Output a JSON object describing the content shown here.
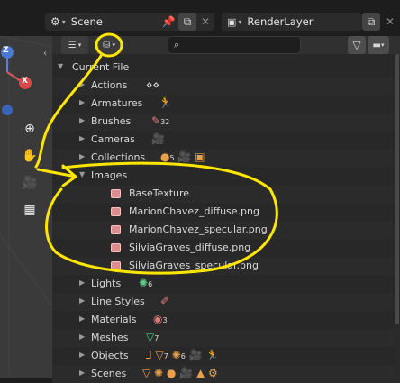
{
  "header": {
    "scene_name": "Scene",
    "view_layer_name": "RenderLayer"
  },
  "outliner": {
    "search_placeholder": "",
    "root": "Current File",
    "categories": [
      {
        "label": "Actions",
        "count": ""
      },
      {
        "label": "Armatures",
        "count": ""
      },
      {
        "label": "Brushes",
        "count": "32"
      },
      {
        "label": "Cameras",
        "count": ""
      },
      {
        "label": "Collections",
        "count": "5"
      },
      {
        "label": "Images",
        "count": ""
      },
      {
        "label": "Lights",
        "count": "6"
      },
      {
        "label": "Line Styles",
        "count": ""
      },
      {
        "label": "Materials",
        "count": "3"
      },
      {
        "label": "Meshes",
        "count": "7"
      },
      {
        "label": "Objects",
        "count": "7",
        "count2": "6"
      },
      {
        "label": "Scenes",
        "count": ""
      }
    ],
    "images": [
      "BaseTexture",
      "MarionChavez_diffuse.png",
      "MarionChavez_specular.png",
      "SilviaGraves_diffuse.png",
      "SilviaGraves_specular.png"
    ]
  },
  "viewport": {
    "axis_z": "Z",
    "axis_x": "X"
  },
  "colors": {
    "annotation": "#ffe600",
    "image_icon": "#d98d8d",
    "light_green": "#5fcf8a",
    "armature_green": "#3fcf8a",
    "object_orange": "#e8a04a"
  }
}
